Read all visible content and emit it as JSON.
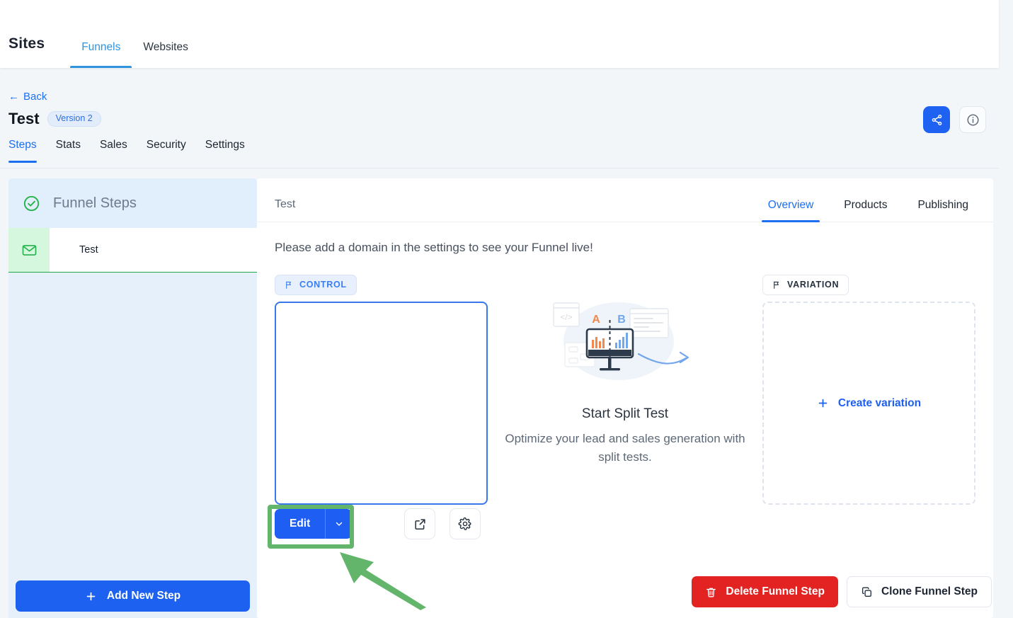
{
  "topnav": {
    "brand": "Sites",
    "tabs": [
      {
        "label": "Funnels",
        "active": true
      },
      {
        "label": "Websites",
        "active": false
      }
    ]
  },
  "header": {
    "back_label": "Back",
    "back_arrow": "←",
    "title": "Test",
    "version_badge": "Version 2",
    "share_icon": "share-icon",
    "info_icon": "info-icon"
  },
  "section_tabs": [
    {
      "label": "Steps",
      "active": true
    },
    {
      "label": "Stats",
      "active": false
    },
    {
      "label": "Sales",
      "active": false
    },
    {
      "label": "Security",
      "active": false
    },
    {
      "label": "Settings",
      "active": false
    }
  ],
  "sidebar": {
    "header_label": "Funnel Steps",
    "header_icon": "check-circle-icon",
    "steps": [
      {
        "label": "Test",
        "icon": "envelope-icon"
      }
    ],
    "add_step_label": "Add New Step",
    "add_step_icon": "plus-icon"
  },
  "main": {
    "step_name": "Test",
    "tabs": [
      {
        "label": "Overview",
        "active": true
      },
      {
        "label": "Products",
        "active": false
      },
      {
        "label": "Publishing",
        "active": false
      }
    ],
    "domain_notice": "Please add a domain in the settings to see your Funnel live!",
    "control": {
      "badge": "CONTROL",
      "badge_icon": "flag-icon",
      "edit_label": "Edit",
      "edit_caret_icon": "chevron-down-icon",
      "preview_icon": "external-link-icon",
      "settings_icon": "gear-icon"
    },
    "variation": {
      "badge": "VARIATION",
      "badge_icon": "flag-icon",
      "create_label": "Create variation",
      "create_icon": "plus-icon"
    },
    "split_promo": {
      "illustration": "ab-split-test-illustration",
      "letter_a": "A",
      "letter_b": "B",
      "title": "Start Split Test",
      "subtitle": "Optimize your lead and sales generation with split tests."
    },
    "footer": {
      "delete_label": "Delete Funnel Step",
      "delete_icon": "trash-icon",
      "clone_label": "Clone Funnel Step",
      "clone_icon": "copy-icon"
    }
  },
  "annotation": {
    "highlight_color": "#62b56b",
    "arrow_icon": "annotation-arrow"
  },
  "colors": {
    "primary_blue": "#1f5ef2",
    "link_blue": "#1d6ff2",
    "topnav_active": "#2f93dd",
    "danger_red": "#e32222",
    "step_green": "#20a64d",
    "annotation_green": "#62b56b",
    "page_bg": "#f2f6f9",
    "sidebar_bg": "#e5f0fa"
  }
}
